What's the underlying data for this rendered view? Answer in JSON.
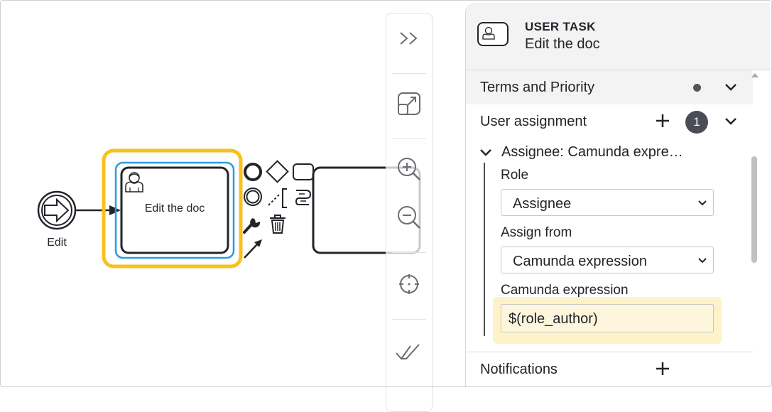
{
  "canvas": {
    "start_event_label": "Edit",
    "task_label": "Edit the doc"
  },
  "panel": {
    "element_type": "USER TASK",
    "element_name": "Edit the doc",
    "groups": {
      "terms": {
        "title": "Terms and Priority"
      },
      "user_assignment": {
        "title": "User assignment",
        "count": "1",
        "entry": {
          "title": "Assignee: Camunda expre…",
          "role_label": "Role",
          "role_value": "Assignee",
          "assign_from_label": "Assign from",
          "assign_from_value": "Camunda expression",
          "expression_label": "Camunda expression",
          "expression_value": "$(role_author)"
        }
      },
      "notifications": {
        "title": "Notifications"
      }
    }
  },
  "colors": {
    "selection": "#f7c21c",
    "selection_inner": "#2b9ae4",
    "highlight": "#fdf2c9"
  }
}
